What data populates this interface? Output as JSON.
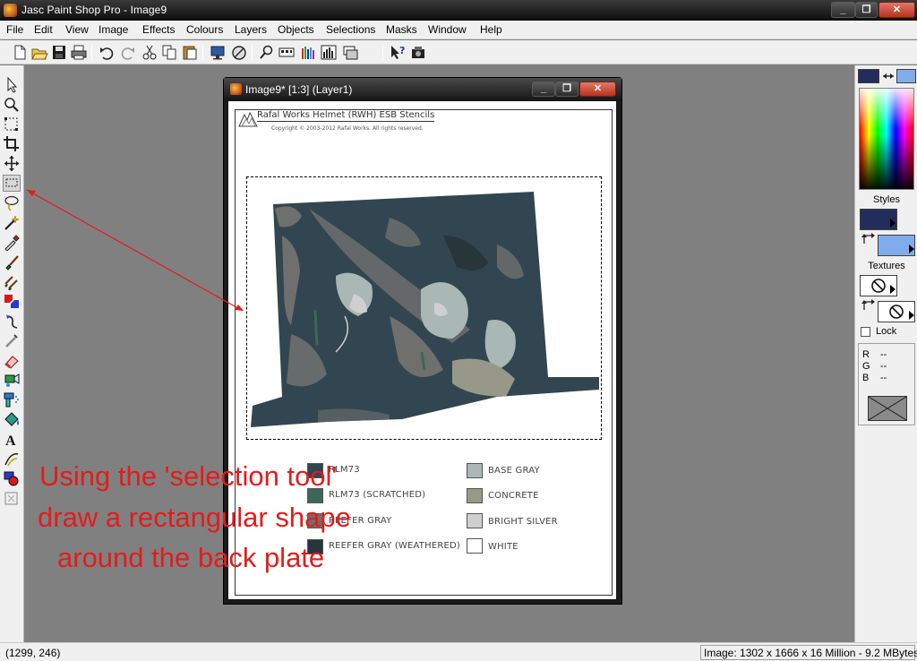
{
  "window": {
    "title": "Jasc Paint Shop Pro - Image9",
    "minimize_glyph": "_",
    "maximize_glyph": "❐",
    "close_glyph": "✕"
  },
  "menu": [
    "File",
    "Edit",
    "View",
    "Image",
    "Effects",
    "Colours",
    "Layers",
    "Objects",
    "Selections",
    "Masks",
    "Window",
    "Help"
  ],
  "toolbar": {
    "icons": [
      "new-icon",
      "open-icon",
      "save-icon",
      "print-icon",
      "undo-icon",
      "redo-icon",
      "cut-icon",
      "copy-icon",
      "paste-icon",
      "screen-preview-icon",
      "browse-icon",
      "zoom-overview-icon",
      "toolbar-icon",
      "histogram-icon",
      "palette-view-icon",
      "layer-palette-icon",
      "help-context-icon",
      "scanner-icon"
    ]
  },
  "tools": {
    "icons": [
      "arrow-icon",
      "zoom-icon",
      "deformation-icon",
      "crop-icon",
      "mover-icon",
      "selection-icon",
      "freehand-icon",
      "magic-wand-icon",
      "dropper-icon",
      "paintbrush-icon",
      "clone-brush-icon",
      "color-replacer-icon",
      "retouch-icon",
      "scratch-remover-icon",
      "eraser-icon",
      "picture-tube-icon",
      "airbrush-icon",
      "flood-fill-icon",
      "text-icon",
      "draw-icon",
      "preset-shapes-icon",
      "object-selector-icon"
    ],
    "selected_index": 5
  },
  "palette": {
    "styles_label": "Styles",
    "textures_label": "Textures",
    "lock_label": "Lock",
    "rgb": {
      "r_label": "R",
      "r_value": "--",
      "g_label": "G",
      "g_value": "--",
      "b_label": "B",
      "b_value": "--"
    },
    "foreground_color": "#232c5a",
    "background_color": "#80acec"
  },
  "document": {
    "title": "Image9* [1:3] (Layer1)",
    "header_title": "Rafal Works Helmet (RWH) ESB Stencils",
    "copyright": "Copyright © 2003-2012 Rafal Works. All rights reserved.",
    "plate_color": "#314650",
    "legend": [
      {
        "label": "RLM73",
        "color": "#314650"
      },
      {
        "label": "RLM73 (SCRATCHED)",
        "color": "#3e6658"
      },
      {
        "label": "REEFER GRAY",
        "color": "#6f6f6e"
      },
      {
        "label": "REEFER GRAY (WEATHERED)",
        "color": "#28363b"
      },
      {
        "label": "BASE GRAY",
        "color": "#a9b7b5"
      },
      {
        "label": "CONCRETE",
        "color": "#989888"
      },
      {
        "label": "BRIGHT SILVER",
        "color": "#cfcfcf"
      },
      {
        "label": "WHITE",
        "color": "#ffffff"
      }
    ]
  },
  "annotation": {
    "line1": "Using the 'selection tool'",
    "line2": "draw a rectangular shape",
    "line3": "around the back plate",
    "color": "#e41b1b"
  },
  "status": {
    "coords": "(1299, 246)",
    "image_info": "Image:  1302 x 1666 x 16 Million - 9.2 MBytes"
  }
}
